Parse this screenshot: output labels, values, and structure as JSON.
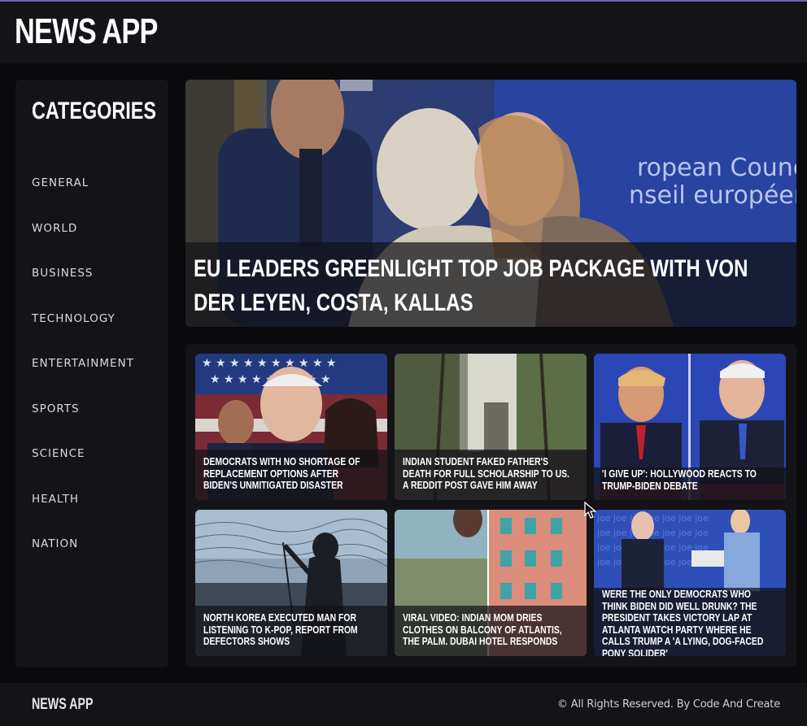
{
  "header": {
    "title": "NEWS APP"
  },
  "sidebar": {
    "title": "CATEGORIES",
    "items": [
      {
        "label": "GENERAL"
      },
      {
        "label": "WORLD"
      },
      {
        "label": "BUSINESS"
      },
      {
        "label": "TECHNOLOGY"
      },
      {
        "label": "ENTERTAINMENT"
      },
      {
        "label": "SPORTS"
      },
      {
        "label": "SCIENCE"
      },
      {
        "label": "HEALTH"
      },
      {
        "label": "NATION"
      }
    ]
  },
  "hero": {
    "title": "EU LEADERS GREENLIGHT TOP JOB PACKAGE WITH VON DER LEYEN, COSTA, KALLAS",
    "image_text_1": "ropean Council",
    "image_text_2": "nseil européen"
  },
  "cards": [
    {
      "title": "DEMOCRATS WITH NO SHORTAGE OF REPLACEMENT OPTIONS AFTER BIDEN'S UNMITIGATED DISASTER"
    },
    {
      "title": "INDIAN STUDENT FAKED FATHER'S DEATH FOR FULL SCHOLARSHIP TO US. A REDDIT POST GAVE HIM AWAY"
    },
    {
      "title": "'I GIVE UP': HOLLYWOOD REACTS TO TRUMP-BIDEN DEBATE"
    },
    {
      "title": "NORTH KOREA EXECUTED MAN FOR LISTENING TO K-POP, REPORT FROM DEFECTORS SHOWS"
    },
    {
      "title": "VIRAL VIDEO: INDIAN MOM DRIES CLOTHES ON BALCONY OF ATLANTIS, THE PALM. DUBAI HOTEL RESPONDS"
    },
    {
      "title": "WERE THE ONLY DEMOCRATS WHO THINK BIDEN DID WELL DRUNK? THE PRESIDENT TAKES VICTORY LAP AT ATLANTA WATCH PARTY WHERE HE CALLS TRUMP A 'A LYING, DOG-FACED PONY SOLIDER'"
    }
  ],
  "footer": {
    "logo": "NEWS APP",
    "copyright": "© All Rights Reserved. By Code And Create"
  }
}
